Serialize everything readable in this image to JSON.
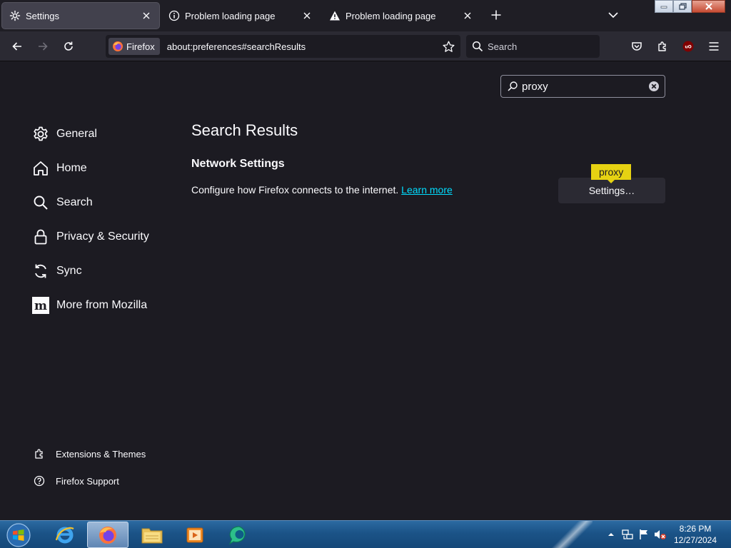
{
  "browser": {
    "tabs": [
      {
        "label": "Settings",
        "icon": "gear-icon",
        "active": true
      },
      {
        "label": "Problem loading page",
        "icon": "info-icon",
        "active": false
      },
      {
        "label": "Problem loading page",
        "icon": "warning-icon",
        "active": false
      }
    ],
    "url": "about:preferences#searchResults",
    "identity_label": "Firefox",
    "search_placeholder": "Search"
  },
  "settings": {
    "search_value": "proxy",
    "nav_items": [
      {
        "label": "General",
        "icon": "gear-icon"
      },
      {
        "label": "Home",
        "icon": "home-icon"
      },
      {
        "label": "Search",
        "icon": "search-icon"
      },
      {
        "label": "Privacy & Security",
        "icon": "lock-icon"
      },
      {
        "label": "Sync",
        "icon": "sync-icon"
      },
      {
        "label": "More from Mozilla",
        "icon": "mozilla-icon"
      }
    ],
    "footer_items": [
      {
        "label": "Extensions & Themes",
        "icon": "puzzle-icon"
      },
      {
        "label": "Firefox Support",
        "icon": "help-icon"
      }
    ],
    "main_title": "Search Results",
    "section_title": "Network Settings",
    "section_desc": "Configure how Firefox connects to the internet.",
    "learn_more": "Learn more",
    "settings_button": "Settings…",
    "highlight_tooltip": "proxy"
  },
  "taskbar": {
    "time": "8:26 PM",
    "date": "12/27/2024"
  },
  "colors": {
    "background": "#1c1b22",
    "link": "#00ddff",
    "highlight": "#e6d212",
    "taskbar": "#1b5387"
  }
}
